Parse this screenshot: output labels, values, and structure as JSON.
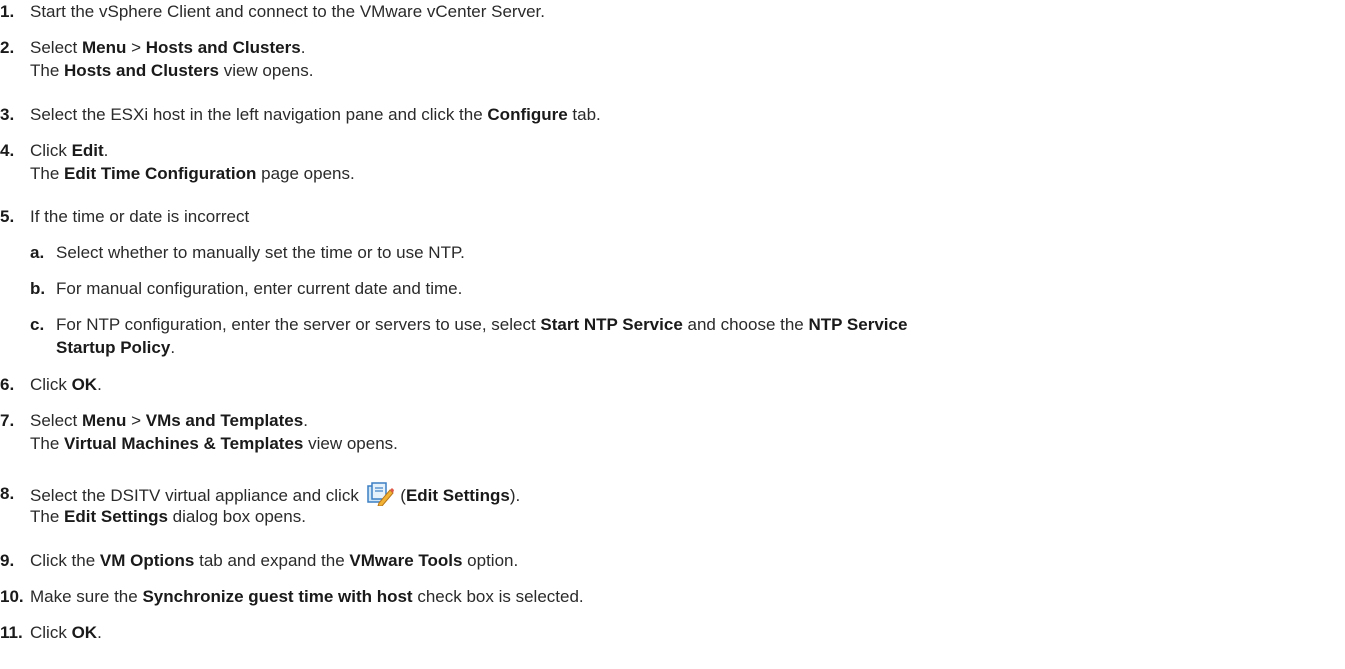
{
  "steps": [
    {
      "num": "1.",
      "lines": [
        [
          "Start the vSphere Client and connect to the VMware vCenter Server."
        ]
      ]
    },
    {
      "num": "2.",
      "lines": [
        [
          "Select ",
          {
            "b": "Menu"
          },
          " > ",
          {
            "b": "Hosts and Clusters"
          },
          "."
        ],
        [
          "The ",
          {
            "b": "Hosts and Clusters"
          },
          " view opens."
        ]
      ]
    },
    {
      "num": "3.",
      "lines": [
        [
          "Select the ESXi host in the left navigation pane and click the ",
          {
            "b": "Configure"
          },
          " tab."
        ]
      ]
    },
    {
      "num": "4.",
      "lines": [
        [
          "Click ",
          {
            "b": "Edit"
          },
          "."
        ],
        [
          "The ",
          {
            "b": "Edit Time Configuration"
          },
          " page opens."
        ]
      ]
    },
    {
      "num": "5.",
      "lines": [
        [
          "If the time or date is incorrect"
        ]
      ]
    },
    {
      "num": "a.",
      "sub": true,
      "lines": [
        [
          "Select whether to manually set the time or to use NTP."
        ]
      ]
    },
    {
      "num": "b.",
      "sub": true,
      "lines": [
        [
          "For manual configuration, enter current date and time."
        ]
      ]
    },
    {
      "num": "c.",
      "sub": true,
      "lines": [
        [
          "For NTP configuration, enter the server or servers to use, select ",
          {
            "b": "Start NTP Service"
          },
          " and choose the ",
          {
            "b": "NTP Service"
          }
        ],
        [
          {
            "b": "Startup Policy"
          },
          "."
        ]
      ]
    },
    {
      "num": "6.",
      "lines": [
        [
          "Click ",
          {
            "b": "OK"
          },
          "."
        ]
      ]
    },
    {
      "num": "7.",
      "lines": [
        [
          "Select ",
          {
            "b": "Menu"
          },
          " > ",
          {
            "b": "VMs and Templates"
          },
          "."
        ],
        [
          "The ",
          {
            "b": "Virtual Machines & Templates"
          },
          " view opens."
        ]
      ]
    },
    {
      "num": "8.",
      "lines": [
        [
          "Select the DSITV virtual appliance and click ",
          {
            "icon": "edit-settings-icon"
          },
          " (",
          {
            "b": "Edit Settings"
          },
          ")."
        ],
        [
          "The ",
          {
            "b": "Edit Settings"
          },
          " dialog box opens."
        ]
      ]
    },
    {
      "num": "9.",
      "lines": [
        [
          "Click the ",
          {
            "b": "VM Options"
          },
          " tab and expand the ",
          {
            "b": "VMware Tools"
          },
          " option."
        ]
      ]
    },
    {
      "num": "10.",
      "lines": [
        [
          "Make sure the ",
          {
            "b": "Synchronize guest time with host"
          },
          " check box is selected."
        ]
      ]
    },
    {
      "num": "11.",
      "lines": [
        [
          "Click ",
          {
            "b": "OK"
          },
          "."
        ]
      ]
    }
  ]
}
